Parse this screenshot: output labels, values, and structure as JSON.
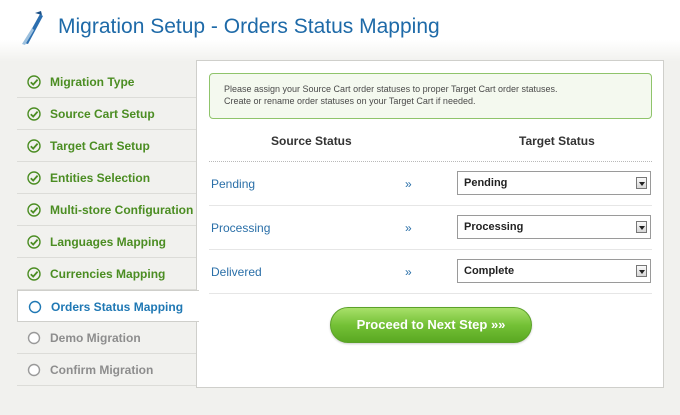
{
  "header": {
    "title": "Migration Setup - Orders Status Mapping"
  },
  "sidebar": {
    "steps": [
      {
        "label": "Migration Type",
        "state": "done"
      },
      {
        "label": "Source Cart Setup",
        "state": "done"
      },
      {
        "label": "Target Cart Setup",
        "state": "done"
      },
      {
        "label": "Entities Selection",
        "state": "done"
      },
      {
        "label": "Multi-store Configuration",
        "state": "done"
      },
      {
        "label": "Languages Mapping",
        "state": "done"
      },
      {
        "label": "Currencies Mapping",
        "state": "done"
      },
      {
        "label": "Orders Status Mapping",
        "state": "active"
      },
      {
        "label": "Demo Migration",
        "state": "pending"
      },
      {
        "label": "Confirm Migration",
        "state": "pending"
      }
    ]
  },
  "notice": {
    "line1": "Please assign your Source Cart order statuses to proper Target Cart order statuses.",
    "line2": "Create or rename order statuses on your Target Cart if needed."
  },
  "table": {
    "source_header": "Source Status",
    "target_header": "Target Status",
    "arrow": "»",
    "rows": [
      {
        "source": "Pending",
        "target": "Pending"
      },
      {
        "source": "Processing",
        "target": "Processing"
      },
      {
        "source": "Delivered",
        "target": "Complete"
      }
    ]
  },
  "actions": {
    "next_label": "Proceed to Next Step »»"
  },
  "colors": {
    "title": "#1e6aa8",
    "done": "#4b8d22",
    "active": "#1f78b4",
    "pending": "#8d8d8d",
    "button": "#74c136"
  }
}
